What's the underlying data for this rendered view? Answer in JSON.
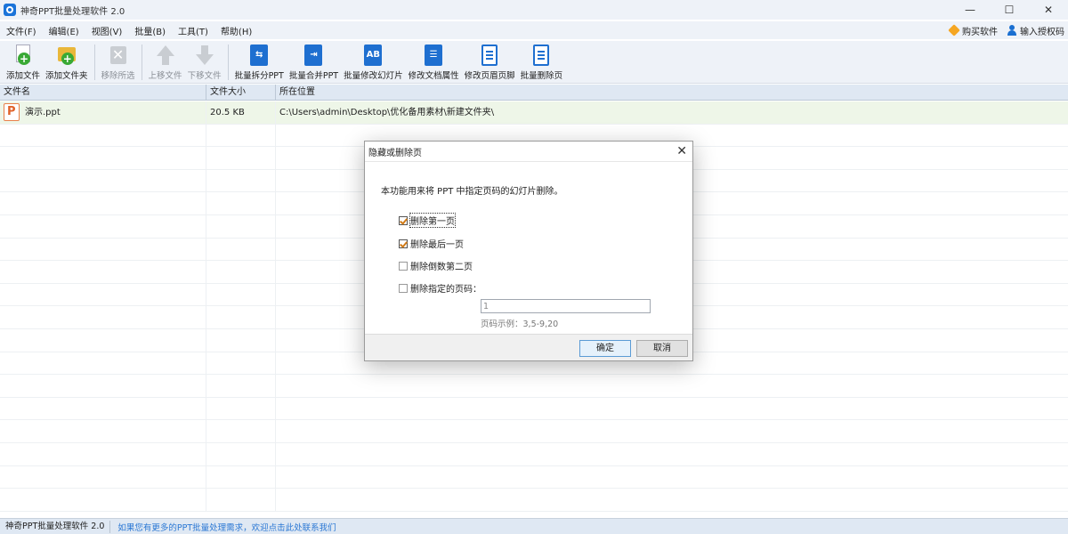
{
  "window": {
    "title": "神奇PPT批量处理软件 2.0",
    "min": "—",
    "max": "☐",
    "close": "✕"
  },
  "menu": [
    "文件(F)",
    "编辑(E)",
    "视图(V)",
    "批量(B)",
    "工具(T)",
    "帮助(H)"
  ],
  "menu_right": {
    "buy": "购买软件",
    "license": "输入授权码"
  },
  "toolbar": {
    "add_file": "添加文件",
    "add_folder": "添加文件夹",
    "remove": "移除所选",
    "move_up": "上移文件",
    "move_down": "下移文件",
    "split": "批量拆分PPT",
    "merge": "批量合并PPT",
    "edit_slides": "批量修改幻灯片",
    "edit_props": "修改文档属性",
    "edit_header": "修改页眉页脚",
    "delete_pages": "批量删除页"
  },
  "table": {
    "headers": [
      "文件名",
      "文件大小",
      "所在位置"
    ],
    "rows": [
      {
        "name": "演示.ppt",
        "size": "20.5 KB",
        "path": "C:\\Users\\admin\\Desktop\\优化备用素材\\新建文件夹\\"
      }
    ]
  },
  "status": {
    "title": "神奇PPT批量处理软件 2.0",
    "link": "如果您有更多的PPT批量处理需求，欢迎点击此处联系我们"
  },
  "dialog": {
    "title": "隐藏或删除页",
    "close": "✕",
    "desc": "本功能用来将 PPT 中指定页码的幻灯片删除。",
    "options": [
      {
        "label": "删除第一页",
        "checked": true
      },
      {
        "label": "删除最后一页",
        "checked": true
      },
      {
        "label": "删除倒数第二页",
        "checked": false
      },
      {
        "label": "删除指定的页码：",
        "checked": false
      }
    ],
    "pages_value": "1",
    "hint": "页码示例：3,5-9,20",
    "ok": "确定",
    "cancel": "取消"
  },
  "colors": {
    "accent": "#1e6fd0",
    "chrome": "#eef2f8",
    "selected_row": "#eef6e8",
    "link": "#2b78d4"
  }
}
